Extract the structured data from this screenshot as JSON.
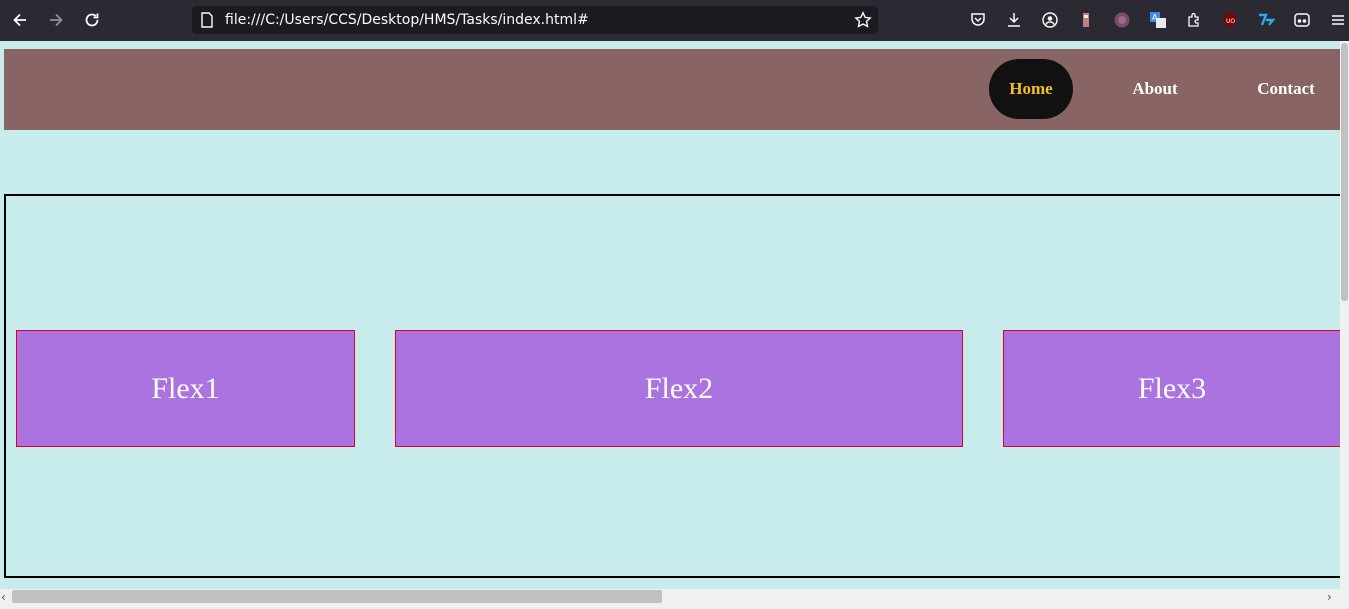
{
  "browser": {
    "url": "file:///C:/Users/CCS/Desktop/HMS/Tasks/index.html#",
    "extensions": [
      "pocket-icon",
      "download-icon",
      "account-icon",
      "extension-a-icon",
      "extension-b-icon",
      "translate-icon",
      "extensions-icon",
      "ublock-icon",
      "todoist-icon",
      "reader-icon",
      "menu-icon"
    ]
  },
  "navbar": {
    "links": [
      {
        "label": "Home",
        "active": true
      },
      {
        "label": "About",
        "active": false
      },
      {
        "label": "Contact",
        "active": false
      }
    ]
  },
  "flex": {
    "items": [
      {
        "label": "Flex1"
      },
      {
        "label": "Flex2"
      },
      {
        "label": "Flex3"
      }
    ]
  },
  "colors": {
    "background": "#c8ebeb",
    "navbar": "#886564",
    "active_link_bg": "#111111",
    "active_link_text": "#f4c020",
    "flex_item": "#ab73df",
    "flex_border": "#e0002a"
  }
}
